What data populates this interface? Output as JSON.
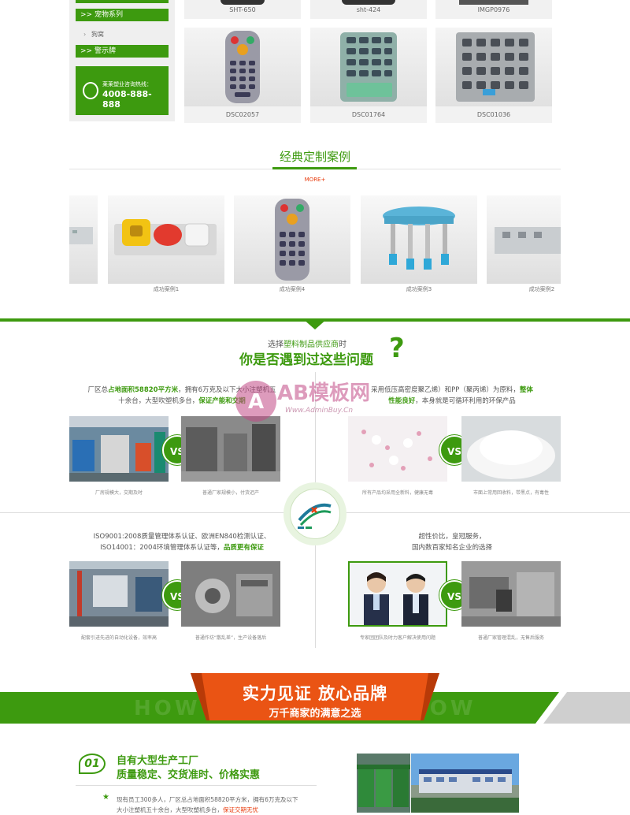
{
  "sidebar": {
    "items": [
      {
        "label": ">> 宠物系列"
      },
      {
        "label": "狗窝"
      },
      {
        "label": ">> 警示牌"
      }
    ],
    "hotline_label": "莱莱塑业咨询热线：",
    "hotline_number": "4008-888-888"
  },
  "products_top": [
    {
      "caption": "SHT-650"
    },
    {
      "caption": "sht-424"
    },
    {
      "caption": "IMGP0976"
    }
  ],
  "products": [
    {
      "caption": "DSC02057"
    },
    {
      "caption": "DSC01764"
    },
    {
      "caption": "DSC01036"
    }
  ],
  "classic": {
    "title": "经典定制案例",
    "more": "MORE+",
    "cases": [
      {
        "caption": "成功案例1"
      },
      {
        "caption": "成功案例4"
      },
      {
        "caption": "成功案例3"
      },
      {
        "caption": "成功案例2"
      }
    ]
  },
  "question": {
    "line1_prefix": "选择",
    "line1_highlight": "塑料制品供应商",
    "line1_suffix": "时",
    "line2": "你是否遇到过这些问题",
    "mark": "?"
  },
  "blocks": {
    "b1": {
      "t1": "厂区总",
      "t1_hl": "占地面积58820平方米",
      "t1_rest": "，拥有6万克及以下大小注塑机五",
      "t2": "十余台，大型吹塑机多台，",
      "t2_hl": "保证产能和交期",
      "cap_left": "厂房规模大，交期及时",
      "cap_right": "普通厂家规模小，付货迟产"
    },
    "b2": {
      "t1": "采用低压高密度聚乙烯）和PP（聚丙烯）为原料，",
      "t1_hl": "整体",
      "t2_hl": "性能良好",
      "t2": "，本身就是可循环利用的环保产品",
      "cap_left": "所有产品均采用全新料，健康无毒",
      "cap_right": "市面上常用回收料，带黑点，有毒性"
    },
    "b3": {
      "t1": "ISO9001:2008质量管理体系认证、欧洲EN840检测认证、",
      "t2": "ISO14001：2004环境管理体系认证等，",
      "t2_hl": "品质更有保证",
      "cap_left": "配套引进先进的自动化设备，效率高",
      "cap_right": "普通作坊“散乱差”，生产设备落后"
    },
    "b4": {
      "t1": "超性价比，皇冠服务，",
      "t2": "国内数百家知名企业的选择",
      "cap_left": "专家团团队及时力客户解决使用问题",
      "cap_right": "普通厂家管理混乱，无售后服务"
    },
    "vs": "VS"
  },
  "watermark": {
    "brand": "AB模板网",
    "url": "Www.AdminBuy.Cn"
  },
  "banner": {
    "title": "实力见证 放心品牌",
    "subtitle": "万千商家的满意之选",
    "bg_text_left": "HOW",
    "bg_text_right": "HOW"
  },
  "factory": {
    "num": "01",
    "title": "自有大型生产工厂",
    "subtitle": "质量稳定、交货准时、价格实惠",
    "desc1": "现有员工300多人，厂区总占地面积58820平方米，拥有6万克及以下",
    "desc2": "大小注塑机五十余台，大型吹塑机多台，",
    "desc2_hl": "保证交期无忧"
  },
  "colors": {
    "green": "#3d9a0f",
    "orange": "#e83c0e"
  }
}
